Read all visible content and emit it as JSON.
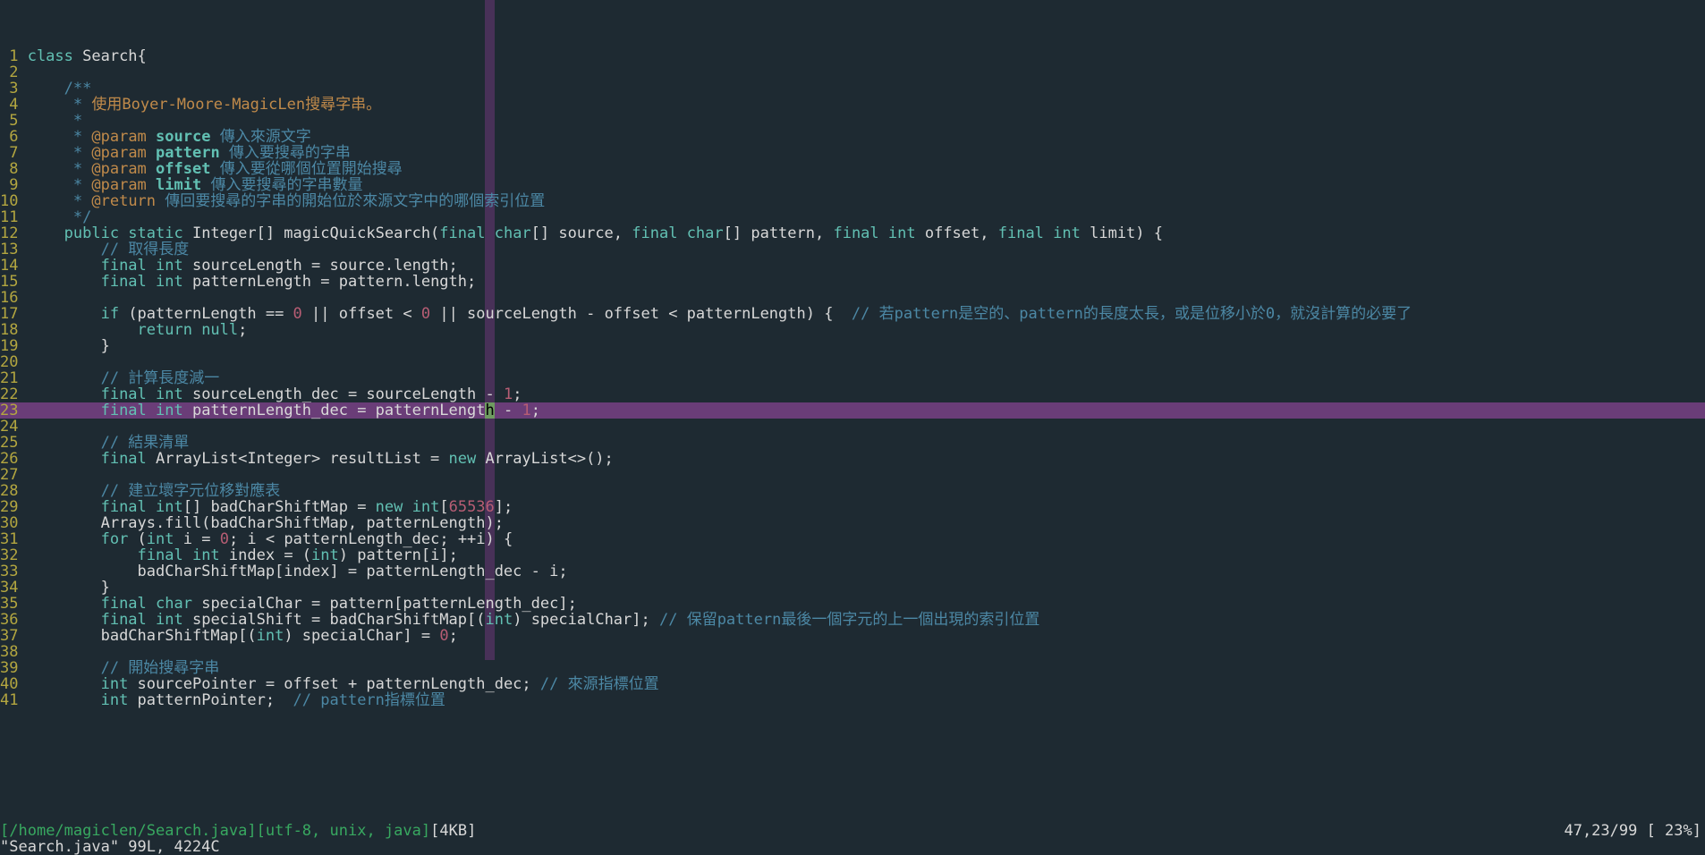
{
  "editor": {
    "file_name": "Search.java",
    "file_path": "/home/magiclen/Search.java",
    "encoding": "utf-8, unix, java",
    "size_label": "4KB",
    "cursor_pos": "47,23/99 [ 23%]",
    "cmdline_msg": "\"Search.java\" 99L, 4224C",
    "color_column": 50,
    "cursor_line_index": 22,
    "cursor_col": 50,
    "visible_line_first": 1,
    "visible_line_last": 41
  },
  "lines": [
    {
      "n": 1,
      "tokens": [
        [
          "kw",
          "class "
        ],
        [
          "id",
          "Search{"
        ]
      ]
    },
    {
      "n": 2,
      "tokens": []
    },
    {
      "n": 3,
      "indent": "    ",
      "tokens": [
        [
          "jdoc",
          "/**"
        ]
      ]
    },
    {
      "n": 4,
      "indent": "     ",
      "tokens": [
        [
          "jdoc",
          "* "
        ],
        [
          "str",
          "使用Boyer-Moore-MagicLen搜尋字串。"
        ]
      ]
    },
    {
      "n": 5,
      "indent": "     ",
      "tokens": [
        [
          "jdoc",
          "*"
        ]
      ]
    },
    {
      "n": 6,
      "indent": "     ",
      "tokens": [
        [
          "jdoc",
          "* "
        ],
        [
          "jtag",
          "@param "
        ],
        [
          "jname",
          "source"
        ],
        [
          "tag-text",
          " 傳入來源文字"
        ]
      ]
    },
    {
      "n": 7,
      "indent": "     ",
      "tokens": [
        [
          "jdoc",
          "* "
        ],
        [
          "jtag",
          "@param "
        ],
        [
          "jname",
          "pattern"
        ],
        [
          "tag-text",
          " 傳入要搜尋的字串"
        ]
      ]
    },
    {
      "n": 8,
      "indent": "     ",
      "tokens": [
        [
          "jdoc",
          "* "
        ],
        [
          "jtag",
          "@param "
        ],
        [
          "jname",
          "offset"
        ],
        [
          "tag-text",
          " 傳入要從哪個位置開始搜尋"
        ]
      ]
    },
    {
      "n": 9,
      "indent": "     ",
      "tokens": [
        [
          "jdoc",
          "* "
        ],
        [
          "jtag",
          "@param "
        ],
        [
          "jname",
          "limit"
        ],
        [
          "tag-text",
          " 傳入要搜尋的字串數量"
        ]
      ]
    },
    {
      "n": 10,
      "indent": "     ",
      "tokens": [
        [
          "jdoc",
          "* "
        ],
        [
          "jtag",
          "@return"
        ],
        [
          "tag-text",
          " 傳回要搜尋的字串的開始位於來源文字中的哪個索引位置"
        ]
      ]
    },
    {
      "n": 11,
      "indent": "     ",
      "tokens": [
        [
          "jdoc",
          "*/"
        ]
      ]
    },
    {
      "n": 12,
      "indent": "    ",
      "tokens": [
        [
          "kw",
          "public static "
        ],
        [
          "id",
          "Integer[] magicQuickSearch("
        ],
        [
          "kw",
          "final "
        ],
        [
          "type",
          "char"
        ],
        [
          "id",
          "[] source, "
        ],
        [
          "kw",
          "final "
        ],
        [
          "type",
          "char"
        ],
        [
          "id",
          "[] pattern, "
        ],
        [
          "kw",
          "final "
        ],
        [
          "type",
          "int"
        ],
        [
          "id",
          " offset, "
        ],
        [
          "kw",
          "final "
        ],
        [
          "type",
          "int"
        ],
        [
          "id",
          " limit) {"
        ]
      ]
    },
    {
      "n": 13,
      "indent": "        ",
      "tokens": [
        [
          "comment",
          "// 取得長度"
        ]
      ]
    },
    {
      "n": 14,
      "indent": "        ",
      "tokens": [
        [
          "kw",
          "final "
        ],
        [
          "type",
          "int"
        ],
        [
          "id",
          " sourceLength = source.length;"
        ]
      ]
    },
    {
      "n": 15,
      "indent": "        ",
      "tokens": [
        [
          "kw",
          "final "
        ],
        [
          "type",
          "int"
        ],
        [
          "id",
          " patternLength = pattern.length;"
        ]
      ]
    },
    {
      "n": 16,
      "tokens": []
    },
    {
      "n": 17,
      "indent": "        ",
      "tokens": [
        [
          "kw",
          "if"
        ],
        [
          "id",
          " (patternLength == "
        ],
        [
          "num",
          "0"
        ],
        [
          "id",
          " || offset < "
        ],
        [
          "num",
          "0"
        ],
        [
          "id",
          " || sourceLength - offset < patternLength) {  "
        ],
        [
          "comment",
          "// 若pattern是空的、pattern的長度太長，或是位移小於0，就沒計算的必要了"
        ]
      ]
    },
    {
      "n": 18,
      "indent": "            ",
      "tokens": [
        [
          "kw",
          "return "
        ],
        [
          "type",
          "null"
        ],
        [
          "id",
          ";"
        ]
      ]
    },
    {
      "n": 19,
      "indent": "        ",
      "tokens": [
        [
          "id",
          "}"
        ]
      ]
    },
    {
      "n": 20,
      "tokens": []
    },
    {
      "n": 21,
      "indent": "        ",
      "tokens": [
        [
          "comment",
          "// 計算長度減一"
        ]
      ]
    },
    {
      "n": 22,
      "indent": "        ",
      "tokens": [
        [
          "kw",
          "final "
        ],
        [
          "type",
          "int"
        ],
        [
          "id",
          " sourceLength_dec = sourceLength - "
        ],
        [
          "num",
          "1"
        ],
        [
          "id",
          ";"
        ]
      ]
    },
    {
      "n": 23,
      "indent": "        ",
      "tokens": [
        [
          "kw",
          "final "
        ],
        [
          "type",
          "int"
        ],
        [
          "id",
          " patternLength_dec = patternLength - "
        ],
        [
          "num",
          "1"
        ],
        [
          "id",
          ";"
        ]
      ]
    },
    {
      "n": 24,
      "tokens": []
    },
    {
      "n": 25,
      "indent": "        ",
      "tokens": [
        [
          "comment",
          "// 結果清單"
        ]
      ]
    },
    {
      "n": 26,
      "indent": "        ",
      "tokens": [
        [
          "kw",
          "final "
        ],
        [
          "id",
          "ArrayList<Integer> resultList = "
        ],
        [
          "kw",
          "new "
        ],
        [
          "id",
          "ArrayList<>();"
        ]
      ]
    },
    {
      "n": 27,
      "tokens": []
    },
    {
      "n": 28,
      "indent": "        ",
      "tokens": [
        [
          "comment",
          "// 建立壞字元位移對應表"
        ]
      ]
    },
    {
      "n": 29,
      "indent": "        ",
      "tokens": [
        [
          "kw",
          "final "
        ],
        [
          "type",
          "int"
        ],
        [
          "id",
          "[] badCharShiftMap = "
        ],
        [
          "kw",
          "new "
        ],
        [
          "type",
          "int"
        ],
        [
          "id",
          "["
        ],
        [
          "num",
          "65536"
        ],
        [
          "id",
          "];"
        ]
      ]
    },
    {
      "n": 30,
      "indent": "        ",
      "tokens": [
        [
          "id",
          "Arrays.fill(badCharShiftMap, patternLength);"
        ]
      ]
    },
    {
      "n": 31,
      "indent": "        ",
      "tokens": [
        [
          "kw",
          "for"
        ],
        [
          "id",
          " ("
        ],
        [
          "type",
          "int"
        ],
        [
          "id",
          " i = "
        ],
        [
          "num",
          "0"
        ],
        [
          "id",
          "; i < patternLength_dec; ++i) {"
        ]
      ]
    },
    {
      "n": 32,
      "indent": "            ",
      "tokens": [
        [
          "kw",
          "final "
        ],
        [
          "type",
          "int"
        ],
        [
          "id",
          " index = ("
        ],
        [
          "type",
          "int"
        ],
        [
          "id",
          ") pattern[i];"
        ]
      ]
    },
    {
      "n": 33,
      "indent": "            ",
      "tokens": [
        [
          "id",
          "badCharShiftMap[index] = patternLength_dec - i;"
        ]
      ]
    },
    {
      "n": 34,
      "indent": "        ",
      "tokens": [
        [
          "id",
          "}"
        ]
      ]
    },
    {
      "n": 35,
      "indent": "        ",
      "tokens": [
        [
          "kw",
          "final "
        ],
        [
          "type",
          "char"
        ],
        [
          "id",
          " specialChar = pattern[patternLength_dec];"
        ]
      ]
    },
    {
      "n": 36,
      "indent": "        ",
      "tokens": [
        [
          "kw",
          "final "
        ],
        [
          "type",
          "int"
        ],
        [
          "id",
          " specialShift = badCharShiftMap[("
        ],
        [
          "type",
          "int"
        ],
        [
          "id",
          ") specialChar]; "
        ],
        [
          "comment",
          "// 保留pattern最後一個字元的上一個出現的索引位置"
        ]
      ]
    },
    {
      "n": 37,
      "indent": "        ",
      "tokens": [
        [
          "id",
          "badCharShiftMap[("
        ],
        [
          "type",
          "int"
        ],
        [
          "id",
          ") specialChar] = "
        ],
        [
          "num",
          "0"
        ],
        [
          "id",
          ";"
        ]
      ]
    },
    {
      "n": 38,
      "tokens": []
    },
    {
      "n": 39,
      "indent": "        ",
      "tokens": [
        [
          "comment",
          "// 開始搜尋字串"
        ]
      ]
    },
    {
      "n": 40,
      "indent": "        ",
      "tokens": [
        [
          "type",
          "int"
        ],
        [
          "id",
          " sourcePointer = offset + patternLength_dec; "
        ],
        [
          "comment",
          "// 來源指標位置"
        ]
      ]
    },
    {
      "n": 41,
      "indent": "        ",
      "tokens": [
        [
          "type",
          "int"
        ],
        [
          "id",
          " patternPointer;  "
        ],
        [
          "comment",
          "// pattern指標位置"
        ]
      ]
    }
  ]
}
